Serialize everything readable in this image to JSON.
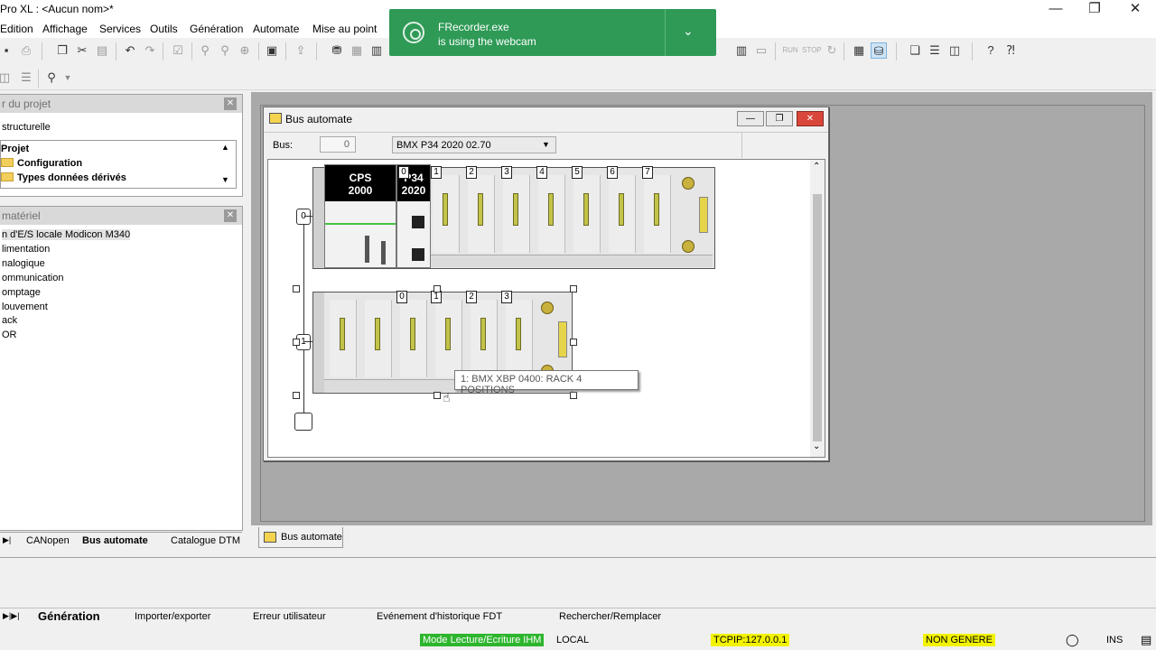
{
  "window": {
    "title": "Pro XL : <Aucun nom>*",
    "minimize": "—",
    "restore": "❐",
    "close": "✕"
  },
  "menu": [
    "Edition",
    "Affichage",
    "Services",
    "Outils",
    "Génération",
    "Automate",
    "Mise au point"
  ],
  "toast": {
    "app": "FRecorder.exe",
    "message": "is using the webcam",
    "chevron": "⌄",
    "color": "#2e9a56"
  },
  "project_panel": {
    "header": "r du projet",
    "view": "structurelle",
    "items": [
      "Projet",
      "Configuration",
      "Types données dérivés"
    ]
  },
  "hardware_panel": {
    "header": "matériel",
    "items": [
      "n d'E/S locale Modicon M340",
      "limentation",
      "nalogique",
      "ommunication",
      "omptage",
      "louvement",
      "ack",
      "OR"
    ]
  },
  "left_tabs": [
    "CANopen",
    "Bus automate",
    "Catalogue DTM"
  ],
  "bus_window": {
    "title": "Bus automate",
    "bus_label": "Bus:",
    "bus_value": "0",
    "cpu_select": "BMX P34 2020   02.70"
  },
  "rack0": {
    "number": "0",
    "power_supply": [
      "CPS",
      "2000"
    ],
    "cpu": [
      "P34",
      "2020"
    ],
    "slot_numbers": [
      "0",
      "1",
      "2",
      "3",
      "4",
      "5",
      "6",
      "7"
    ]
  },
  "rack1": {
    "number": "1",
    "slot_numbers": [
      "0",
      "1",
      "2",
      "3"
    ]
  },
  "tooltip": "1: BMX XBP 0400: RACK 4 POSITIONS",
  "window_tab": "Bus automate",
  "output_tabs": [
    "Génération",
    "Importer/exporter",
    "Erreur utilisateur",
    "Evénement d'historique FDT",
    "Rechercher/Remplacer"
  ],
  "status": {
    "mode": "Mode Lecture/Ecriture IHM",
    "location": "LOCAL",
    "address": "TCPIP:127.0.0.1",
    "build": "NON GENERE",
    "ins": "INS",
    "mode_color": "#2db52d",
    "highlight_color": "#f3f300"
  }
}
